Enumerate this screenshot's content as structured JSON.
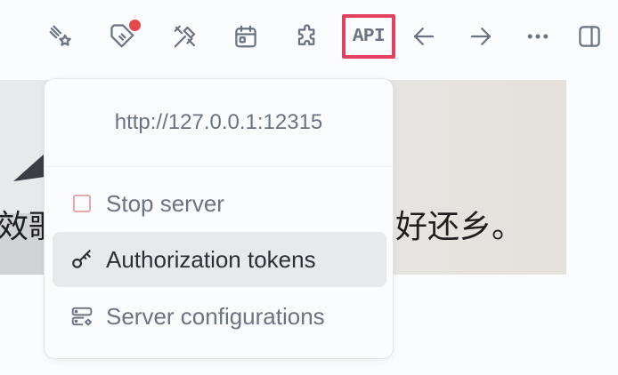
{
  "toolbar": {
    "icons": [
      "sparkles-star-icon",
      "tag-with-notification-icon",
      "tools-icon",
      "calendar-icon",
      "puzzle-icon",
      "api-button",
      "arrow-left-icon",
      "arrow-right-icon",
      "more-icon",
      "sidebar-toggle-icon"
    ],
    "api_label": "API",
    "highlight_color": "#e4405f",
    "badge_color": "#e5484d"
  },
  "document": {
    "text_left": "效歌",
    "text_right": "好还乡。"
  },
  "popup": {
    "server_url": "http://127.0.0.1:12315",
    "items": [
      {
        "label": "Stop server",
        "icon": "stop-square-icon",
        "active": false
      },
      {
        "label": "Authorization tokens",
        "icon": "key-icon",
        "active": true
      },
      {
        "label": "Server configurations",
        "icon": "server-settings-icon",
        "active": false
      }
    ]
  }
}
